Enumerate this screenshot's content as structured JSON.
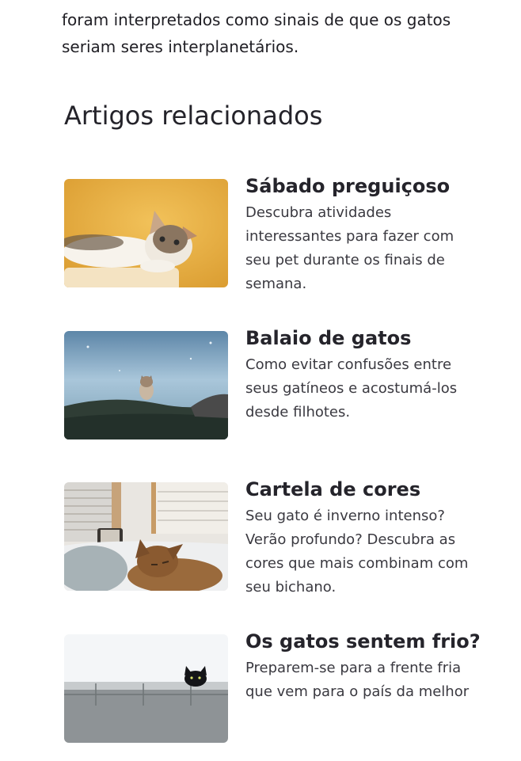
{
  "intro_text": "foram interpretados como sinais de que os gatos seriam seres interplanetários.",
  "related": {
    "heading": "Artigos relacionados",
    "articles": [
      {
        "title": "Sábado preguiçoso",
        "description": "Descubra atividades interessantes para fazer com seu pet durante os finais de semana.",
        "image_icon": "kitten-on-yellow-photo"
      },
      {
        "title": "Balaio de gatos",
        "description": "Como evitar confusões entre seus gatíneos e acostumá-los desde filhotes.",
        "image_icon": "kitten-in-field-photo"
      },
      {
        "title": "Cartela de cores",
        "description": "Seu gato é inverno intenso? Verão profundo? Descubra as cores que mais combinam com seu bichano.",
        "image_icon": "cat-sleeping-on-bed-photo"
      },
      {
        "title": "Os gatos sentem frio?",
        "description": "Preparem-se para a frente fria que vem para o país da melhor",
        "image_icon": "black-cat-behind-wall-photo"
      }
    ]
  }
}
